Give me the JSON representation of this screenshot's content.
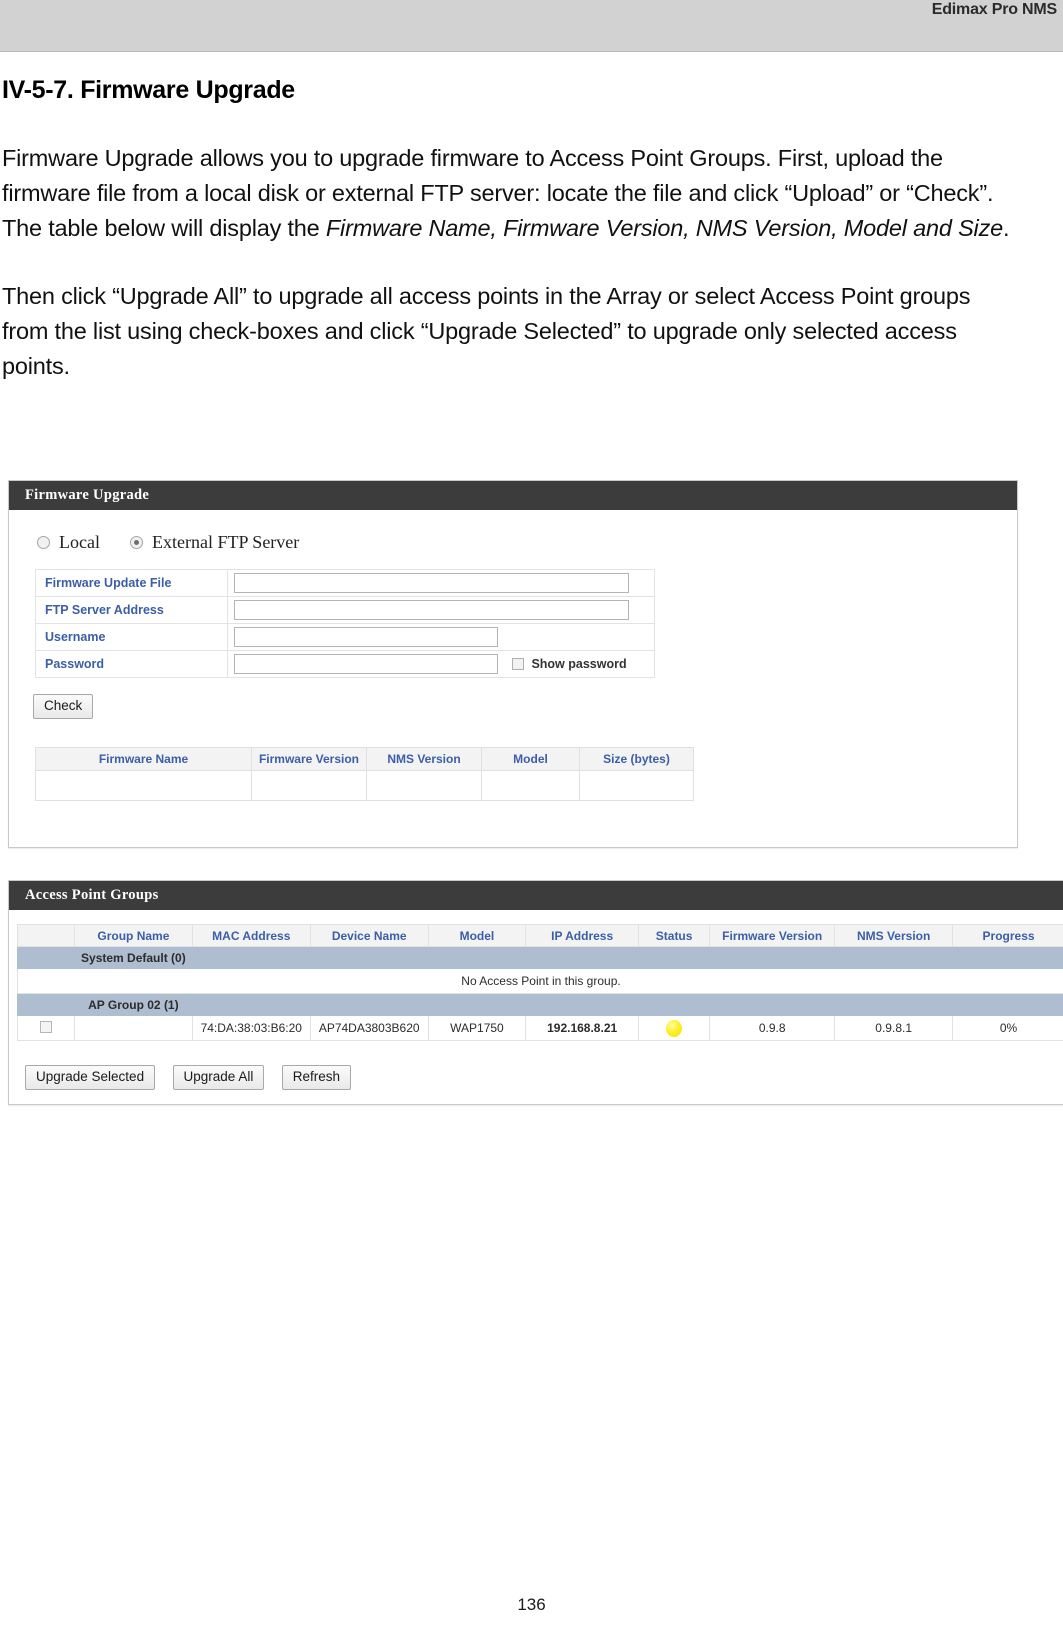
{
  "header": {
    "brand": "Edimax Pro NMS"
  },
  "document": {
    "section_title": "IV-5-7. Firmware Upgrade",
    "paragraph_1_part1": "Firmware Upgrade allows you to upgrade firmware to Access Point Groups. First, upload the firmware file from a local disk or external FTP server: locate the file and click “Upload” or “Check”. The table below will display the ",
    "paragraph_1_italic": "Firmware Name, Firmware Version, NMS Version, Model and Size",
    "paragraph_1_part2": ".",
    "paragraph_2": "Then click “Upgrade All” to upgrade all access points in the Array or select Access Point groups from the list using check-boxes and click “Upgrade Selected” to upgrade only selected access points.",
    "page_number": "136"
  },
  "firmware_panel": {
    "title": "Firmware Upgrade",
    "source_options": [
      {
        "label": "Local",
        "selected": false
      },
      {
        "label": "External FTP Server",
        "selected": true
      }
    ],
    "fields": [
      {
        "label": "Firmware Update File",
        "value": "",
        "placeholder": ""
      },
      {
        "label": "FTP Server Address",
        "value": "",
        "placeholder": ""
      },
      {
        "label": "Username",
        "value": "",
        "placeholder": ""
      },
      {
        "label": "Password",
        "value": "",
        "placeholder": ""
      }
    ],
    "show_password_label": "Show password",
    "show_password_checked": false,
    "check_button": "Check",
    "result_table": {
      "columns": [
        "Firmware Name",
        "Firmware Version",
        "NMS Version",
        "Model",
        "Size (bytes)"
      ],
      "rows": [
        [
          "",
          "",
          "",
          "",
          ""
        ]
      ]
    }
  },
  "ap_groups_panel": {
    "title": "Access Point Groups",
    "columns": [
      "",
      "Group Name",
      "MAC Address",
      "Device Name",
      "Model",
      "IP Address",
      "Status",
      "Firmware Version",
      "NMS Version",
      "Progress"
    ],
    "groups": [
      {
        "name": "System Default (0)",
        "empty_message": "No Access Point in this group.",
        "rows": []
      },
      {
        "name": "AP Group 02 (1)",
        "empty_message": "",
        "rows": [
          {
            "checked": false,
            "group_name": "",
            "mac_address": "74:DA:38:03:B6:20",
            "device_name": "AP74DA3803B620",
            "model": "WAP1750",
            "ip_address": "192.168.8.21",
            "status_icon": "yellow-status-dot",
            "firmware_version": "0.9.8",
            "nms_version": "0.9.8.1",
            "progress": "0%"
          }
        ]
      }
    ],
    "buttons": [
      "Upgrade Selected",
      "Upgrade All",
      "Refresh"
    ]
  },
  "colors": {
    "panel_header_bg": "#3c3c3c",
    "label_blue": "#3b5ea8",
    "group_row_bg": "#aebdd0",
    "ip_link": "#3f4fc4",
    "status_yellow": "#ffef29",
    "progress_border": "#3b4f9e",
    "header_band": "#d2d2d2"
  }
}
